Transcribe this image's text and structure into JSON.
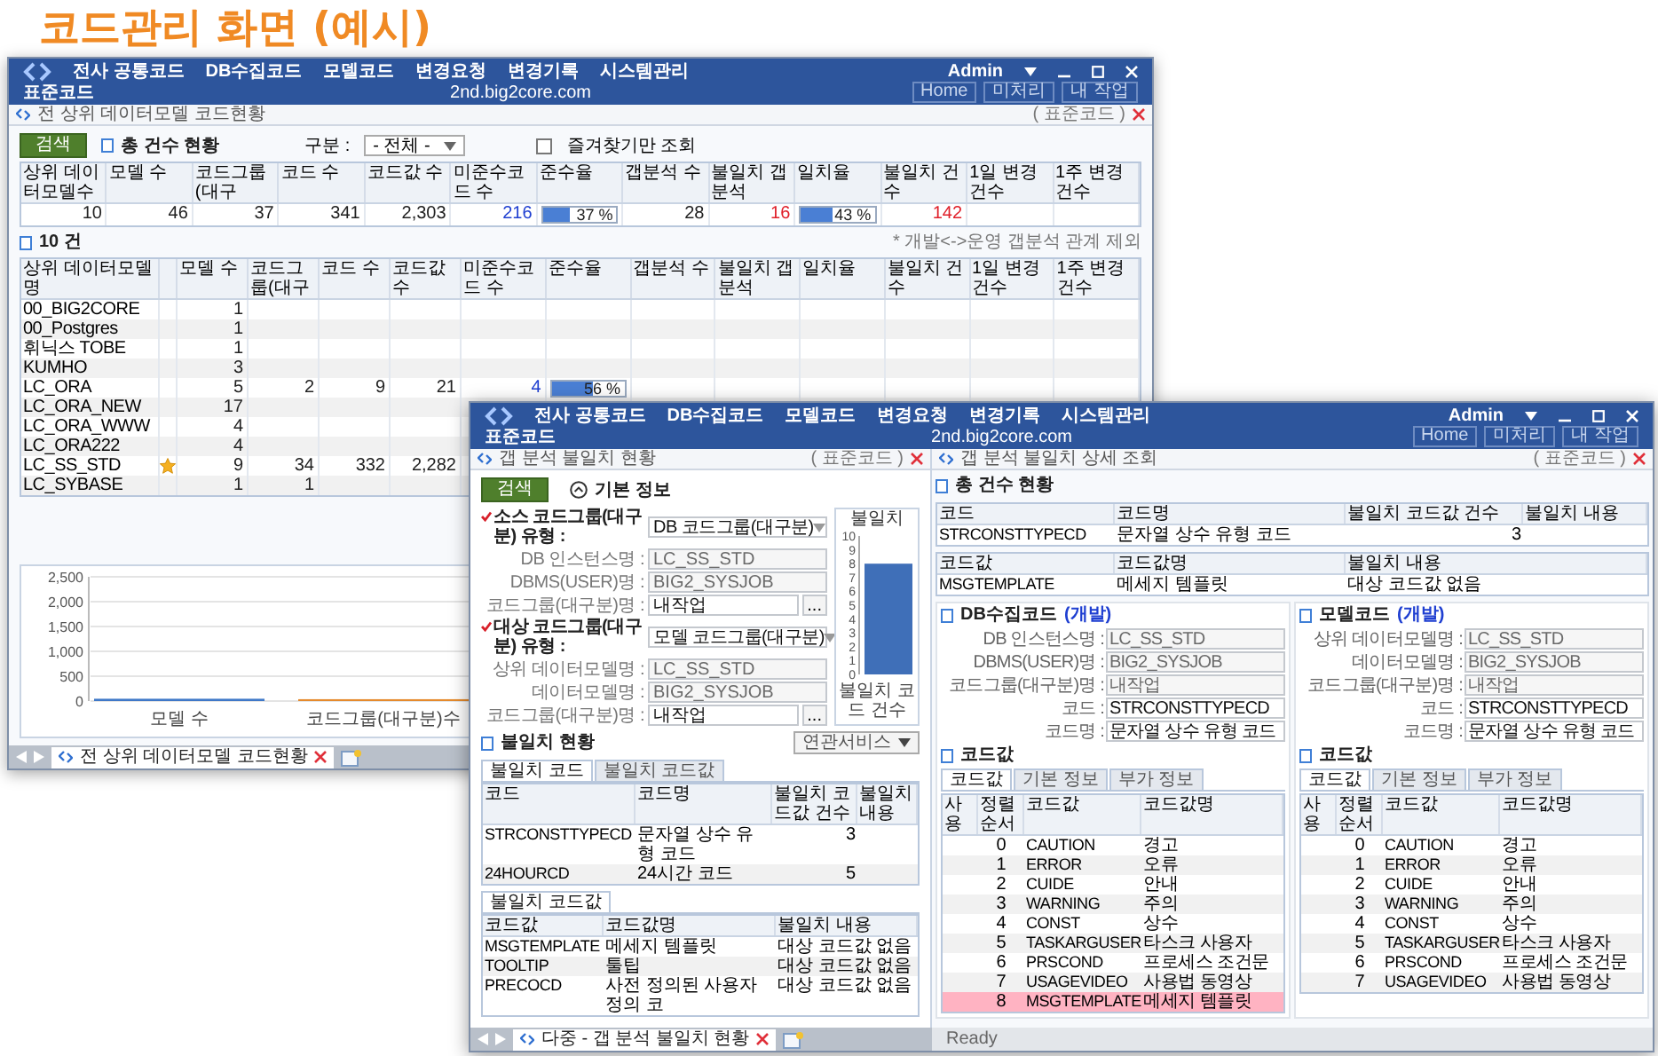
{
  "heading": "코드관리 화면 (예시)",
  "back_window": {
    "menu": [
      "전사 공통코드",
      "DB수집코드",
      "모델코드",
      "변경요청",
      "변경기록",
      "시스템관리"
    ],
    "user": "Admin",
    "screen_title": "표준코드",
    "host": "2nd.big2core.com",
    "nav_buttons": [
      "Home",
      "미처리",
      "내 작업"
    ],
    "breadcrumb": "전 상위 데이터모델 코드현황",
    "breadcrumb_tag": "( 표준코드 )",
    "search_button": "검색",
    "summary_title": "총 건수 현황",
    "filter_label": "구분 :",
    "filter_value": "- 전체 -",
    "favorites_label": "즐겨찾기만 조회",
    "favorites_checked": false,
    "summary_columns": [
      "상위 데이터모델수",
      "모델 수",
      "코드그룹(대구",
      "코드 수",
      "코드값 수",
      "미준수코드 수",
      "준수율",
      "갭분석 수",
      "불일치 갭분석",
      "일치율",
      "불일치 건수",
      "1일 변경 건수",
      "1주 변경 건수"
    ],
    "summary_row": [
      {
        "kind": "number",
        "text": "10"
      },
      {
        "kind": "number",
        "text": "46"
      },
      {
        "kind": "number",
        "text": "37"
      },
      {
        "kind": "number",
        "text": "341"
      },
      {
        "kind": "number",
        "text": "2,303"
      },
      {
        "kind": "link",
        "text": "216"
      },
      {
        "kind": "meter",
        "level": 0.37,
        "text": "37 %"
      },
      {
        "kind": "number",
        "text": "28"
      },
      {
        "kind": "alert",
        "text": "16"
      },
      {
        "kind": "meter",
        "level": 0.43,
        "text": "43 %"
      },
      {
        "kind": "alert",
        "text": "142"
      }
    ],
    "list_title": "10 건",
    "list_note": "* 개발<->운영 갭분석 관계 제외",
    "list_columns": [
      "상위 데이터모델명",
      "모델 수",
      "코드그룹(대구",
      "코드 수",
      "코드값 수",
      "미준수코드 수",
      "준수율",
      "갭분석 수",
      "불일치 갭분석",
      "일치율",
      "불일치 건수",
      "1일 변경 건수",
      "1주 변경 건수"
    ],
    "list_rows": [
      {
        "name": "00_BIG2CORE",
        "starred": false,
        "cells": [
          {
            "kind": "number",
            "text": "1"
          }
        ]
      },
      {
        "name": "00_Postgres",
        "starred": false,
        "cells": [
          {
            "kind": "number",
            "text": "1"
          }
        ]
      },
      {
        "name": "휘닉스 TOBE",
        "starred": false,
        "cells": [
          {
            "kind": "number",
            "text": "1"
          }
        ]
      },
      {
        "name": "KUMHO",
        "starred": false,
        "cells": [
          {
            "kind": "number",
            "text": "3"
          }
        ]
      },
      {
        "name": "LC_ORA",
        "starred": false,
        "cells": [
          {
            "kind": "number",
            "text": "5"
          },
          {
            "kind": "number",
            "text": "2"
          },
          {
            "kind": "number",
            "text": "9"
          },
          {
            "kind": "number",
            "text": "21"
          },
          {
            "kind": "link",
            "text": "4"
          },
          {
            "kind": "meter",
            "level": 0.56,
            "text": "56 %"
          }
        ]
      },
      {
        "name": "LC_ORA_NEW",
        "starred": false,
        "cells": [
          {
            "kind": "number",
            "text": "17"
          }
        ]
      },
      {
        "name": "LC_ORA_WWW",
        "starred": false,
        "cells": [
          {
            "kind": "number",
            "text": "4"
          }
        ]
      },
      {
        "name": "LC_ORA222",
        "starred": false,
        "cells": [
          {
            "kind": "number",
            "text": "4"
          }
        ]
      },
      {
        "name": "LC_SS_STD",
        "starred": true,
        "cells": [
          {
            "kind": "number",
            "text": "9"
          },
          {
            "kind": "number",
            "text": "34"
          },
          {
            "kind": "number",
            "text": "332"
          },
          {
            "kind": "number",
            "text": "2,282"
          }
        ]
      },
      {
        "name": "LC_SYBASE",
        "starred": false,
        "cells": [
          {
            "kind": "number",
            "text": "1"
          },
          {
            "kind": "number",
            "text": "1"
          }
        ]
      }
    ],
    "chart_data": {
      "type": "bar",
      "categories": [
        "모델 수",
        "코드그룹(대구분)수"
      ],
      "values": [
        46,
        37
      ],
      "ylim": [
        0,
        2500
      ],
      "yticks": [
        0,
        500,
        {
          "value": 1000,
          "label": "1,000"
        },
        {
          "value": 1500,
          "label": "1,500"
        },
        {
          "value": 2000,
          "label": "2,000"
        },
        {
          "value": 2500,
          "label": "2,500"
        }
      ],
      "grid": true
    },
    "tabs": [
      {
        "label": "전 상위 데이터모델 코드현황",
        "selected": true
      }
    ]
  },
  "front_window": {
    "menu": [
      "전사 공통코드",
      "DB수집코드",
      "모델코드",
      "변경요청",
      "변경기록",
      "시스템관리"
    ],
    "user": "Admin",
    "screen_title": "표준코드",
    "host": "2nd.big2core.com",
    "nav_buttons": [
      "Home",
      "미처리",
      "내 작업"
    ],
    "left": {
      "breadcrumb": "갭 분석 불일치 현황",
      "breadcrumb_tag": "( 표준코드 )",
      "search_button": "검색",
      "section_title": "기본 정보",
      "expanded": true,
      "form": [
        {
          "kind": "select",
          "label": "소스 코드그룹(대구분) 유형 :",
          "value": "DB 코드그룹(대구분)",
          "required": true,
          "disabled": false
        },
        {
          "kind": "text",
          "label": "DB 인스턴스명 :",
          "value": "LC_SS_STD",
          "required": false,
          "disabled": true
        },
        {
          "kind": "text",
          "label": "DBMS(USER)명 :",
          "value": "BIG2_SYSJOB",
          "required": false,
          "disabled": true
        },
        {
          "kind": "lookup",
          "label": "코드그룹(대구분)명 :",
          "value": "내작업",
          "button": "...",
          "required": false,
          "disabled": false
        },
        {
          "kind": "select",
          "label": "대상 코드그룹(대구분) 유형 :",
          "value": "모델 코드그룹(대구분)",
          "required": true,
          "disabled": false
        },
        {
          "kind": "text",
          "label": "상위 데이터모델명 :",
          "value": "LC_SS_STD",
          "required": false,
          "disabled": true
        },
        {
          "kind": "text",
          "label": "데이터모델명 :",
          "value": "BIG2_SYSJOB",
          "required": false,
          "disabled": true
        },
        {
          "kind": "lookup",
          "label": "코드그룹(대구분)명 :",
          "value": "내작업",
          "button": "...",
          "required": false,
          "disabled": false
        }
      ],
      "chart_data": {
        "type": "bar",
        "title": "불일치",
        "categories": [
          "불일치 코드 건수"
        ],
        "values": [
          8
        ],
        "ylim": [
          0,
          10
        ],
        "yticks": [
          0,
          1,
          2,
          3,
          4,
          5,
          6,
          7,
          8,
          9,
          10
        ]
      },
      "mismatch_title": "불일치 현황",
      "service_dropdown": "연관서비스",
      "code_tabs": [
        {
          "label": "불일치 코드",
          "selected": true
        },
        {
          "label": "불일치 코드값",
          "selected": false
        }
      ],
      "code_table": {
        "columns": [
          "코드",
          "코드명",
          "불일치 코드값 건수",
          "불일치 내용"
        ],
        "rows": [
          [
            "STRCONSTTYPECD",
            "문자열 상수 유형 코드",
            "3"
          ],
          [
            "24HOURCD",
            "24시간 코드",
            "5"
          ]
        ]
      },
      "value_tabs": [
        {
          "label": "불일치 코드값",
          "selected": true
        }
      ],
      "value_table": {
        "columns": [
          "코드값",
          "코드값명",
          "불일치 내용"
        ],
        "rows": [
          [
            "MSGTEMPLATE",
            "메세지 템플릿",
            "대상 코드값 없음"
          ],
          [
            "TOOLTIP",
            "툴팁",
            "대상 코드값 없음"
          ],
          [
            "PRECOCD",
            "사전 정의된 사용자 정의 코",
            "대상 코드값 없음"
          ]
        ]
      }
    },
    "right": {
      "breadcrumb": "갭 분석 불일치 상세 조회",
      "breadcrumb_tag": "( 표준코드 )",
      "summary_title": "총 건수 현황",
      "code_table": {
        "columns": [
          "코드",
          "코드명",
          "불일치 코드값 건수",
          "불일치 내용"
        ],
        "rows": [
          [
            "STRCONSTTYPECD",
            "문자열 상수 유형 코드",
            "3"
          ]
        ]
      },
      "value_table": {
        "columns": [
          "코드값",
          "코드값명",
          "불일치 내용"
        ],
        "rows": [
          [
            "MSGTEMPLATE",
            "메세지 템플릿",
            "대상 코드값 없음"
          ]
        ]
      },
      "sides": [
        {
          "title": "DB수집코드",
          "env": "(개발)",
          "fields": [
            {
              "label": "DB 인스턴스명 :",
              "value": "LC_SS_STD",
              "disabled": true
            },
            {
              "label": "DBMS(USER)명 :",
              "value": "BIG2_SYSJOB",
              "disabled": true
            },
            {
              "label": "코드그룹(대구분)명 :",
              "value": "내작업",
              "disabled": true
            },
            {
              "label": "코드 :",
              "value": "STRCONSTTYPECD",
              "disabled": false
            },
            {
              "label": "코드명 :",
              "value": "문자열 상수 유형 코드",
              "disabled": false
            }
          ],
          "values_title": "코드값",
          "tabs": [
            {
              "label": "코드값",
              "selected": true
            },
            {
              "label": "기본 정보",
              "selected": false
            },
            {
              "label": "부가 정보",
              "selected": false
            }
          ],
          "columns": [
            "사용",
            "정렬 순서",
            "코드값",
            "코드값명"
          ],
          "rows": [
            {
              "order": "0",
              "code": "CAUTION",
              "name": "경고",
              "mismatch": false
            },
            {
              "order": "1",
              "code": "ERROR",
              "name": "오류",
              "mismatch": false
            },
            {
              "order": "2",
              "code": "CUIDE",
              "name": "안내",
              "mismatch": false
            },
            {
              "order": "3",
              "code": "WARNING",
              "name": "주의",
              "mismatch": false
            },
            {
              "order": "4",
              "code": "CONST",
              "name": "상수",
              "mismatch": false
            },
            {
              "order": "5",
              "code": "TASKARGUSER",
              "name": "타스크 사용자",
              "mismatch": false
            },
            {
              "order": "6",
              "code": "PRSCOND",
              "name": "프로세스 조건문",
              "mismatch": false
            },
            {
              "order": "7",
              "code": "USAGEVIDEO",
              "name": "사용법 동영상",
              "mismatch": false
            },
            {
              "order": "8",
              "code": "MSGTEMPLATE",
              "name": "메세지 템플릿",
              "mismatch": true
            }
          ]
        },
        {
          "title": "모델코드",
          "env": "(개발)",
          "fields": [
            {
              "label": "상위 데이터모델명 :",
              "value": "LC_SS_STD",
              "disabled": true
            },
            {
              "label": "데이터모델명 :",
              "value": "BIG2_SYSJOB",
              "disabled": true
            },
            {
              "label": "코드그룹(대구분)명 :",
              "value": "내작업",
              "disabled": true
            },
            {
              "label": "코드 :",
              "value": "STRCONSTTYPECD",
              "disabled": false
            },
            {
              "label": "코드명 :",
              "value": "문자열 상수 유형 코드",
              "disabled": false
            }
          ],
          "values_title": "코드값",
          "tabs": [
            {
              "label": "코드값",
              "selected": true
            },
            {
              "label": "기본 정보",
              "selected": false
            },
            {
              "label": "부가 정보",
              "selected": false
            }
          ],
          "columns": [
            "사용",
            "정렬 순서",
            "코드값",
            "코드값명"
          ],
          "rows": [
            {
              "order": "0",
              "code": "CAUTION",
              "name": "경고",
              "mismatch": false
            },
            {
              "order": "1",
              "code": "ERROR",
              "name": "오류",
              "mismatch": false
            },
            {
              "order": "2",
              "code": "CUIDE",
              "name": "안내",
              "mismatch": false
            },
            {
              "order": "3",
              "code": "WARNING",
              "name": "주의",
              "mismatch": false
            },
            {
              "order": "4",
              "code": "CONST",
              "name": "상수",
              "mismatch": false
            },
            {
              "order": "5",
              "code": "TASKARGUSER",
              "name": "타스크 사용자",
              "mismatch": false
            },
            {
              "order": "6",
              "code": "PRSCOND",
              "name": "프로세스 조건문",
              "mismatch": false
            },
            {
              "order": "7",
              "code": "USAGEVIDEO",
              "name": "사용법 동영상",
              "mismatch": false
            }
          ]
        }
      ]
    },
    "bottom_tabs": [
      {
        "label": "다중 - 갭 분석 불일치 현황",
        "selected": true
      }
    ],
    "status": "Ready"
  }
}
